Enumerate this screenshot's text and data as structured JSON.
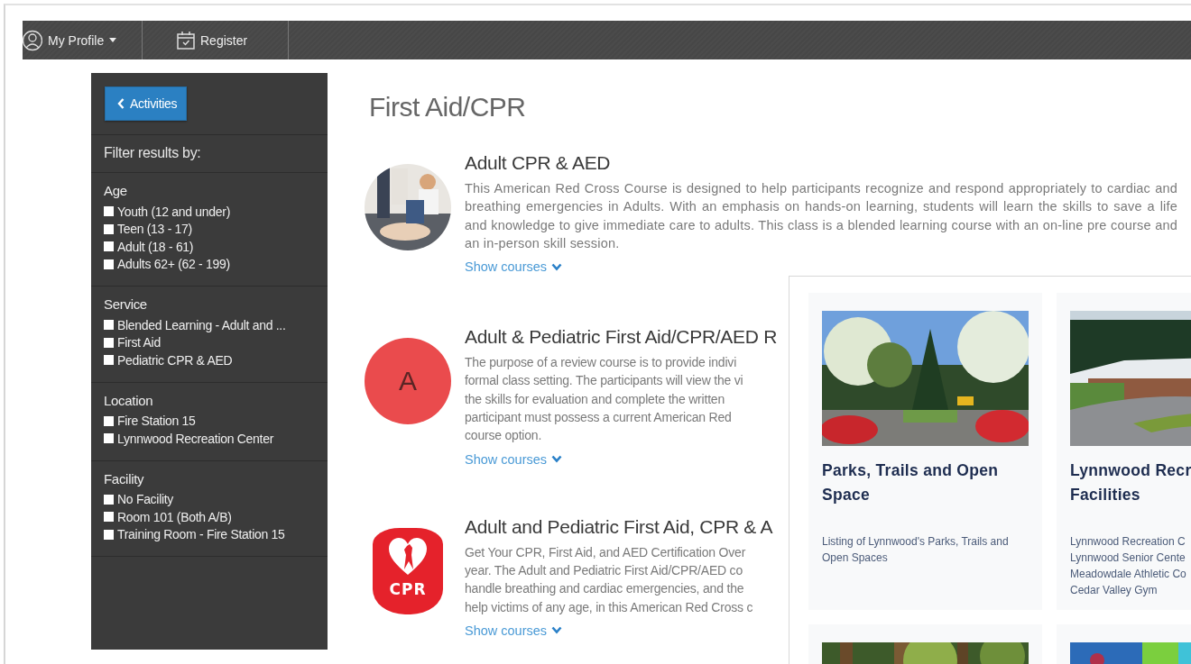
{
  "nav": {
    "items": [
      {
        "kind": "profile",
        "label": "My Profile",
        "dropdown": true
      },
      {
        "kind": "register",
        "label": "Register",
        "dropdown": false
      }
    ]
  },
  "sidebar": {
    "back_button": "Activities",
    "filter_title": "Filter results by:",
    "groups": [
      {
        "title": "Age",
        "options": [
          {
            "label": "Youth (12 and under)",
            "checked": false
          },
          {
            "label": "Teen (13 - 17)",
            "checked": false
          },
          {
            "label": "Adult (18 - 61)",
            "checked": false
          },
          {
            "label": "Adults 62+ (62 - 199)",
            "checked": false
          }
        ]
      },
      {
        "title": "Service",
        "options": [
          {
            "label": "Blended Learning - Adult and ...",
            "checked": false
          },
          {
            "label": "First Aid",
            "checked": false
          },
          {
            "label": "Pediatric CPR & AED",
            "checked": false
          }
        ]
      },
      {
        "title": "Location",
        "options": [
          {
            "label": "Fire Station 15",
            "checked": false
          },
          {
            "label": "Lynnwood Recreation Center",
            "checked": false
          }
        ]
      },
      {
        "title": "Facility",
        "options": [
          {
            "label": "No Facility",
            "checked": false
          },
          {
            "label": "Room 101 (Both A/B)",
            "checked": false
          },
          {
            "label": "Training Room - Fire Station 15",
            "checked": false
          }
        ]
      }
    ]
  },
  "page": {
    "title": "First Aid/CPR"
  },
  "courses": [
    {
      "title": "Adult CPR & AED",
      "description": "This American Red Cross Course is designed to help participants recognize and respond appropriately to cardiac and breathing emergencies in Adults. With an emphasis on hands-on learning, students will learn the skills to save a life and knowledge to give immediate care to adults. This class is a blended learning course with an on-line pre course and an in-person skill session.",
      "link": "Show courses"
    },
    {
      "kind": "letter",
      "letter": "A",
      "title": "Adult & Pediatric First Aid/CPR/AED R",
      "description_lines": [
        "The purpose of a review course is to provide indivi",
        "formal class setting. The participants will view the vi",
        "the skills for evaluation and complete the written",
        "participant must possess a current American Red",
        "course option."
      ],
      "link": "Show courses"
    },
    {
      "kind": "logo",
      "logo_text": "CPR",
      "title": "Adult and Pediatric First Aid, CPR & A",
      "description_lines": [
        "Get Your CPR, First Aid, and AED Certification Over",
        "year. The Adult and Pediatric First Aid/CPR/AED co",
        "handle breathing and cardiac emergencies, and the",
        "help victims of any age, in this American Red Cross c"
      ],
      "link": "Show courses"
    }
  ],
  "overlay": {
    "cards": [
      {
        "kind": "tile",
        "title": "Parks, Trails and Open Space",
        "description": "Listing of Lynnwood's Parks, Trails and Open Spaces"
      },
      {
        "kind": "tile",
        "title_lines": [
          "Lynnwood Recr",
          "Facilities"
        ],
        "description_lines": [
          "Lynnwood Recreation C",
          "Lynnwood Senior Cente",
          "Meadowdale Athletic Co",
          "Cedar Valley Gym"
        ]
      },
      {
        "kind": "picture"
      },
      {
        "kind": "picture"
      }
    ]
  }
}
